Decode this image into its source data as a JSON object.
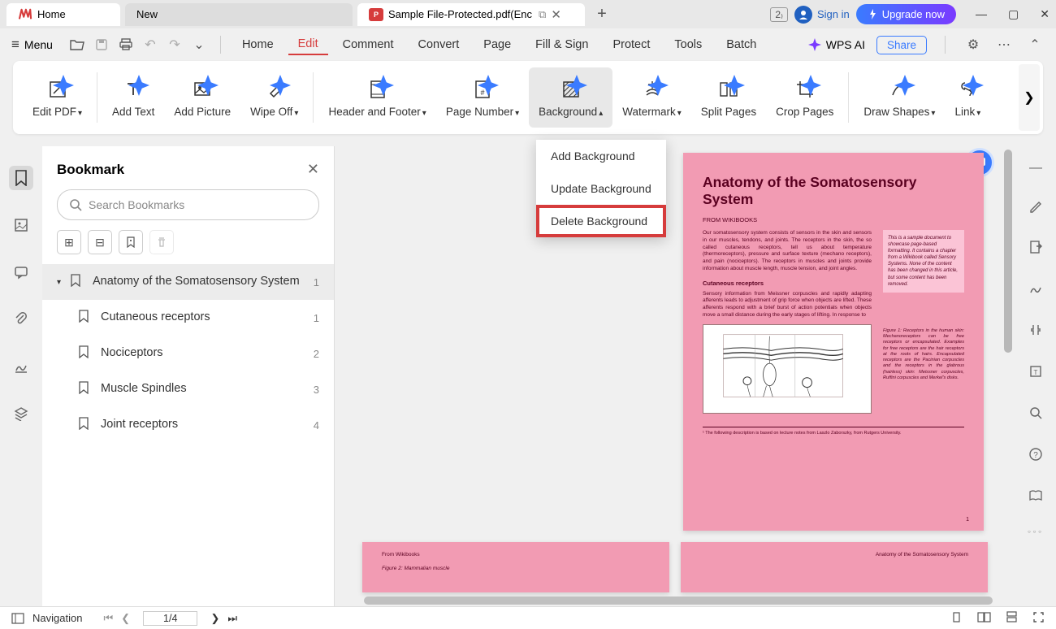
{
  "tabs": {
    "home": "Home",
    "new": "New",
    "file": "Sample File-Protected.pdf(Enc"
  },
  "titlebar": {
    "presence": "2",
    "signin": "Sign in",
    "upgrade": "Upgrade now"
  },
  "menubar": {
    "menu": "Menu",
    "items": [
      "Home",
      "Edit",
      "Comment",
      "Convert",
      "Page",
      "Fill & Sign",
      "Protect",
      "Tools",
      "Batch"
    ],
    "wps_ai": "WPS AI",
    "share": "Share"
  },
  "ribbon": {
    "edit_pdf": "Edit PDF",
    "add_text": "Add Text",
    "add_picture": "Add Picture",
    "wipe_off": "Wipe Off",
    "header_footer": "Header and Footer",
    "page_number": "Page Number",
    "background": "Background",
    "watermark": "Watermark",
    "split_pages": "Split Pages",
    "crop_pages": "Crop Pages",
    "draw_shapes": "Draw Shapes",
    "link": "Link"
  },
  "dropdown": {
    "add": "Add Background",
    "update": "Update Background",
    "delete": "Delete Background"
  },
  "sidebar": {
    "title": "Bookmark",
    "search_placeholder": "Search Bookmarks",
    "items": [
      {
        "label": "Anatomy of the Somatosensory System",
        "page": "1"
      },
      {
        "label": "Cutaneous receptors",
        "page": "1"
      },
      {
        "label": "Nociceptors",
        "page": "2"
      },
      {
        "label": "Muscle Spindles",
        "page": "3"
      },
      {
        "label": "Joint receptors",
        "page": "4"
      }
    ]
  },
  "document": {
    "title": "Anatomy of the Somatosensory System",
    "from": "FROM WIKIBOOKS",
    "para1": "Our somatosensory system consists of sensors in the skin and sensors in our muscles, tendons, and joints. The receptors in the skin, the so called cutaneous receptors, tell us about temperature (thermoreceptors), pressure and surface texture (mechano receptors), and pain (nociceptors). The receptors in muscles and joints provide information about muscle length, muscle tension, and joint angles.",
    "note": "This is a sample document to showcase page-based formatting. It contains a chapter from a Wikibook called Sensory Systems. None of the content has been changed in this article, but some content has been removed.",
    "section1": "Cutaneous receptors",
    "para2": "Sensory information from Meissner corpuscles and rapidly adapting afferents leads to adjustment of grip force when objects are lifted. These afferents respond with a brief burst of action potentials when objects move a small distance during the early stages of lifting. In response to",
    "figure_caption": "Figure 1: Receptors in the human skin: Mechanoreceptors can be free receptors or encapsulated. Examples for free receptors are the hair receptors at the roots of hairs. Encapsulated receptors are the Pacinian corpuscles and the receptors in the glabrous (hairless) skin: Meissner corpuscles, Ruffini corpuscles and Merkel's disks.",
    "footnote": "¹ The following description is based on lecture notes from Laszlo Zaborszky, from Rutgers University.",
    "pagenum": "1",
    "p2_from": "From Wikibooks",
    "p2_fig": "Figure 2: Mammalian muscle",
    "p3_header": "Anatomy of the Somatosensory System"
  },
  "statusbar": {
    "nav": "Navigation",
    "page": "1/4"
  }
}
